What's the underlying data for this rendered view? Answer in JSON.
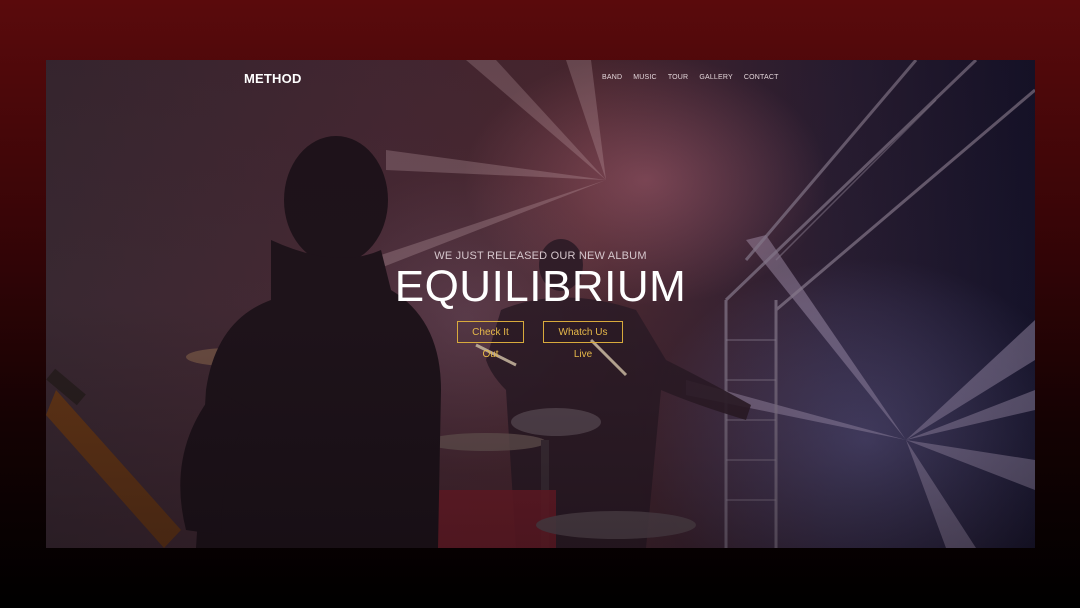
{
  "brand": {
    "name": "METHOD"
  },
  "nav": {
    "items": [
      "BAND",
      "MUSIC",
      "TOUR",
      "GALLERY",
      "CONTACT"
    ]
  },
  "hero": {
    "subtitle": "WE JUST RELEASED OUR NEW ALBUM",
    "title": "EQUILIBRIUM",
    "buttons": [
      "Check It Out",
      "Whatch Us Live"
    ]
  },
  "colors": {
    "accent": "#d8aa3c",
    "backdrop": "#5a0a0c"
  }
}
